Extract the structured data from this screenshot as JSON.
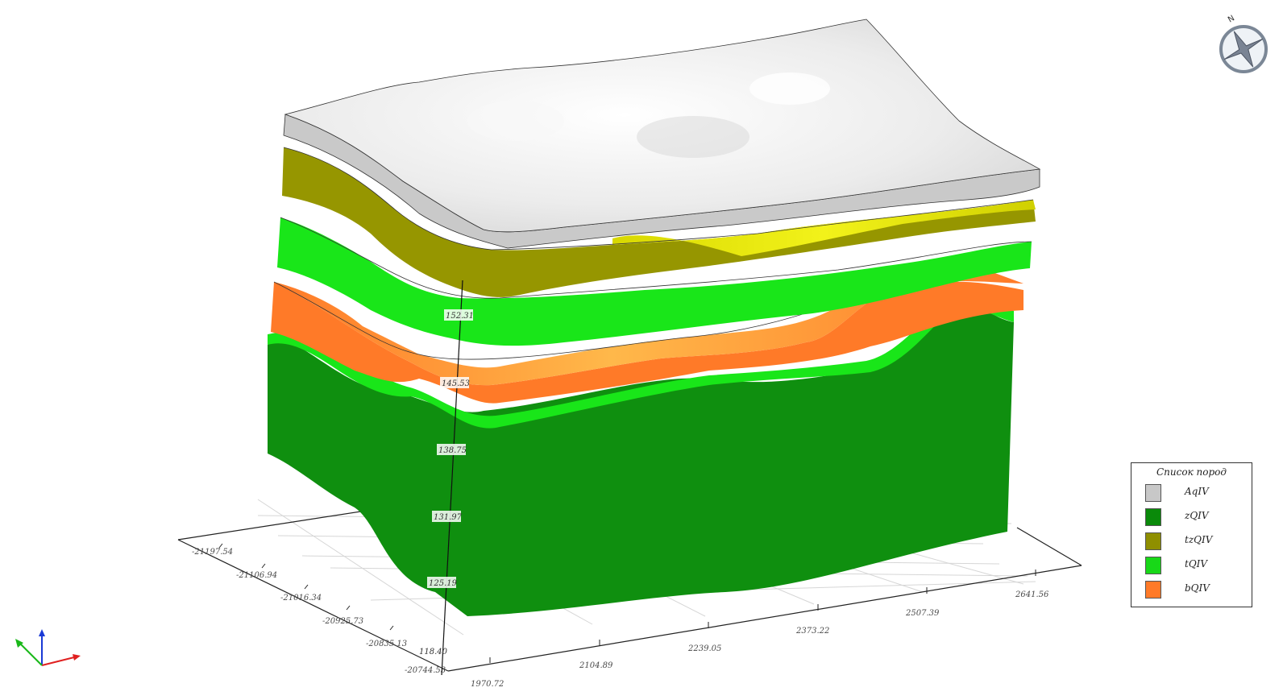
{
  "legend": {
    "title": "Список пород",
    "items": [
      {
        "label": "AqIV",
        "color": "#c8c8c8"
      },
      {
        "label": "zQIV",
        "color": "#0a8a0a"
      },
      {
        "label": "tzQIV",
        "color": "#8f8f00"
      },
      {
        "label": "tQIV",
        "color": "#18d818"
      },
      {
        "label": "bQIV",
        "color": "#ff7a28"
      }
    ]
  },
  "axes": {
    "z_ticks": [
      "152.31",
      "145.53",
      "138.75",
      "131.97",
      "125.19",
      "118.40"
    ],
    "y_ticks": [
      "-21197.54",
      "-21106.94",
      "-21016.34",
      "-20925.73",
      "-20835.13",
      "-20744.53"
    ],
    "x_ticks": [
      "1970.72",
      "2104.89",
      "2239.05",
      "2373.22",
      "2507.39",
      "2641.56"
    ]
  },
  "compass": {
    "north_label": "N"
  },
  "colors": {
    "AqIV_top": "#e6e6e6",
    "AqIV_side": "#c9c9c9",
    "tzQIV": "#969600",
    "tzQIV_light": "#e1e100",
    "tQIV": "#19e619",
    "bQIV": "#ff7a28",
    "bQIV_light": "#ffb040",
    "zQIV": "#0f8f0f"
  }
}
